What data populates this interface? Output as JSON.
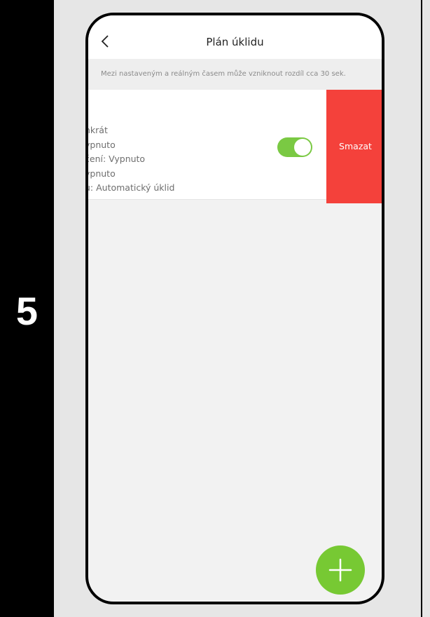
{
  "step_number": "5",
  "header": {
    "title": "Plán úklidu",
    "back_icon": "chevron-left-icon"
  },
  "info_banner": "Mezi nastaveným a reálným časem může vzniknout rozdíl cca 30 sek.",
  "schedule_item": {
    "lines": [
      "nkrát",
      "ypnuto",
      "čení: Vypnuto",
      "ypnuto",
      "u: Automatický úklid"
    ],
    "enabled": true,
    "delete_label": "Smazat"
  },
  "fab_icon": "plus-icon",
  "colors": {
    "accent_green": "#77c933",
    "delete_red": "#f4413b",
    "background": "#f2f2f2"
  }
}
